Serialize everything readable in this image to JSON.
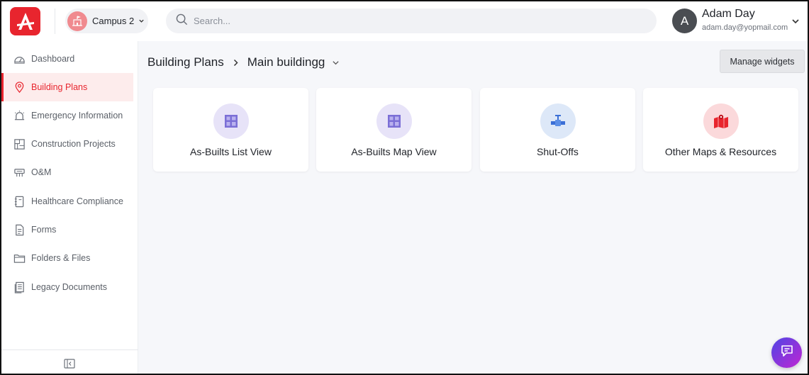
{
  "header": {
    "campus_label": "Campus 2",
    "search_placeholder": "Search...",
    "user": {
      "initial": "A",
      "name": "Adam Day",
      "email": "adam.day@yopmail.com"
    }
  },
  "sidebar": {
    "items": [
      {
        "label": "Dashboard",
        "icon": "dashboard-icon",
        "active": false
      },
      {
        "label": "Building Plans",
        "icon": "map-pin-icon",
        "active": true
      },
      {
        "label": "Emergency Information",
        "icon": "alarm-light-icon",
        "active": false
      },
      {
        "label": "Construction Projects",
        "icon": "blueprint-icon",
        "active": false
      },
      {
        "label": "O&M",
        "icon": "maintenance-icon",
        "active": false
      },
      {
        "label": "Healthcare Compliance",
        "icon": "notebook-icon",
        "active": false
      },
      {
        "label": "Forms",
        "icon": "form-icon",
        "active": false
      },
      {
        "label": "Folders & Files",
        "icon": "folder-icon",
        "active": false
      },
      {
        "label": "Legacy Documents",
        "icon": "documents-icon",
        "active": false
      }
    ]
  },
  "main": {
    "breadcrumb": {
      "root": "Building Plans",
      "current": "Main buildingg"
    },
    "manage_widgets_label": "Manage widgets",
    "widgets": [
      {
        "label": "As-Builts List View",
        "icon": "floorplan-icon",
        "color": "#e7e3f8"
      },
      {
        "label": "As-Builts Map View",
        "icon": "floorplan-icon",
        "color": "#e7e3f8"
      },
      {
        "label": "Shut-Offs",
        "icon": "valve-icon",
        "color": "#dde8f8"
      },
      {
        "label": "Other Maps & Resources",
        "icon": "map-icon",
        "color": "#fbd9db"
      }
    ]
  },
  "colors": {
    "brand": "#e8252e",
    "sidebar_active_bg": "#fdecec",
    "page_bg": "#f6f7fa"
  }
}
